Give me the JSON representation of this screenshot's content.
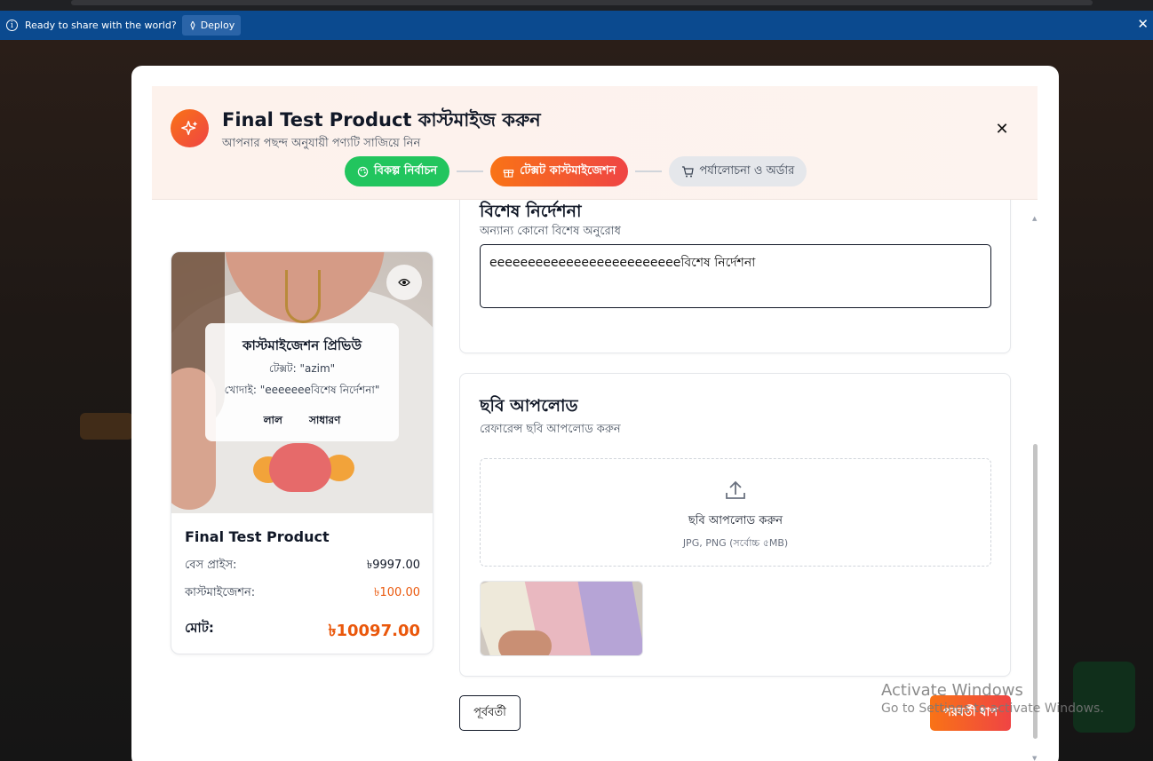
{
  "browser": {
    "infobar_message": "Ready to share with the world?",
    "deploy_label": "Deploy"
  },
  "modal": {
    "title": "Final Test Product কাস্টমাইজ করুন",
    "subtitle": "আপনার পছন্দ অনুযায়ী পণ্যটি সাজিয়ে নিন",
    "steps": [
      {
        "label": "বিকল্প নির্বাচন",
        "state": "done"
      },
      {
        "label": "টেক্সট কাস্টমাইজেশন",
        "state": "active"
      },
      {
        "label": "পর্যালোচনা ও অর্ডার",
        "state": "pending"
      }
    ]
  },
  "preview": {
    "title": "কাস্টমাইজেশন প্রিভিউ",
    "text_line": "টেক্সট: \"azim\"",
    "engraving_line": "খোদাই: \"eeeeeeeবিশেষ নির্দেশনা\"",
    "tags": [
      "লাল",
      "সাধারণ"
    ]
  },
  "product": {
    "name": "Final Test Product",
    "base_price_label": "বেস প্রাইস:",
    "base_price": "৳9997.00",
    "custom_label": "কাস্টমাইজেশন:",
    "custom_price": "৳100.00",
    "total_label": "মোট:",
    "total_price": "৳10097.00"
  },
  "instructions": {
    "title": "বিশেষ নির্দেশনা",
    "subtitle": "অন্যান্য কোনো বিশেষ অনুরোধ",
    "value": "eeeeeeeeeeeeeeeeeeeeeeeeeবিশেষ নির্দেশনা"
  },
  "upload": {
    "title": "ছবি আপলোড",
    "subtitle": "রেফারেন্স ছবি আপলোড করুন",
    "drop_label": "ছবি আপলোড করুন",
    "hint": "JPG, PNG (সর্বোচ্চ ৫MB)"
  },
  "nav": {
    "prev_label": "পূর্ববর্তী",
    "next_label": "পরবর্তী ধাপ"
  },
  "watermark": {
    "line1": "Activate Windows",
    "line2": "Go to Settings to activate Windows."
  }
}
